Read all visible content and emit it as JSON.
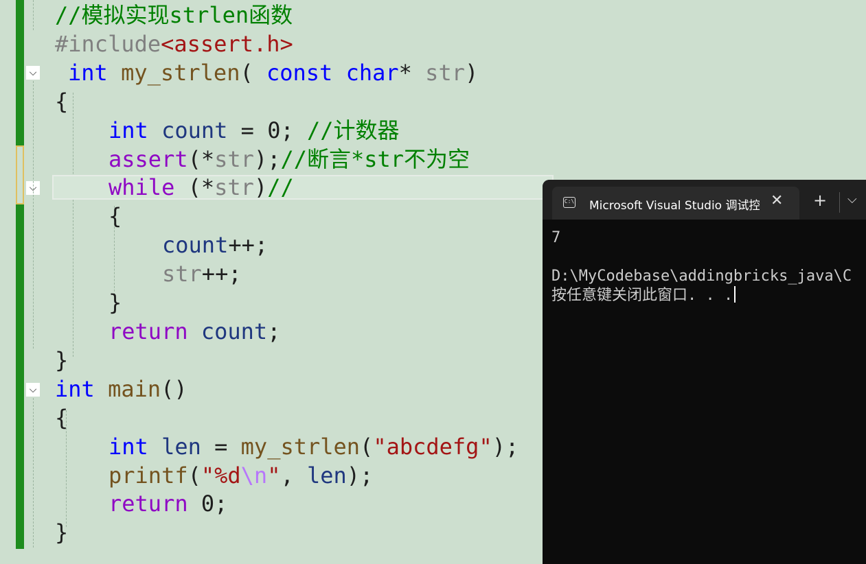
{
  "editor": {
    "lines": {
      "l1": {
        "comment": "//模拟实现strlen函数"
      },
      "l2": {
        "directive": "#include",
        "header": "<assert.h>"
      },
      "l3": {
        "kw_int": "int",
        "fn": "my_strlen",
        "p1": "( ",
        "kw_const": "const",
        "sp1": " ",
        "kw_char": "char",
        "star": "* ",
        "param": "str",
        "p2": ")"
      },
      "l4": {
        "brace": "{"
      },
      "l5": {
        "kw_int": "int",
        "sp": " ",
        "var": "count",
        "rest": " = 0; ",
        "comment": "//计数器"
      },
      "l6": {
        "ctl": "assert",
        "p1": "(*",
        "param": "str",
        "p2": ");",
        "comment": "//断言*str不为空"
      },
      "l7": {
        "ctl": "while",
        "p1": " (*",
        "param": "str",
        "p2": ")",
        "comment": "//"
      },
      "l8": {
        "brace": "{"
      },
      "l9": {
        "var": "count",
        "rest": "++;"
      },
      "l10": {
        "param": "str",
        "rest": "++;"
      },
      "l11": {
        "brace": "}"
      },
      "l12": {
        "ctl": "return",
        "sp": " ",
        "var": "count",
        "rest": ";"
      },
      "l13": {
        "brace": "}"
      },
      "l14": {
        "kw_int": "int",
        "sp": " ",
        "fn": "main",
        "rest": "()"
      },
      "l15": {
        "brace": "{"
      },
      "l16": {
        "kw_int": "int",
        "sp": " ",
        "var": "len",
        "eq": " = ",
        "fn": "my_strlen",
        "p1": "(",
        "str": "\"abcdefg\"",
        "p2": ");"
      },
      "l17": {
        "fn": "printf",
        "p1": "(",
        "str1": "\"%d",
        "esc": "\\n",
        "str2": "\"",
        "p2": ", ",
        "var": "len",
        "p3": ");"
      },
      "l18": {
        "ctl": "return",
        "rest": " 0;"
      },
      "l19": {
        "brace": "}"
      }
    }
  },
  "console": {
    "tab_title": "Microsoft Visual Studio 调试控制台",
    "tab_icon_text": "C:\\",
    "close_glyph": "✕",
    "add_glyph": "+",
    "dropdown_glyph": "⌵",
    "output": [
      "7",
      "",
      "D:\\MyCodebase\\addingbricks_java\\C",
      "按任意键关闭此窗口. . ."
    ]
  },
  "icons": {
    "collapse": "chevron-down-icon"
  },
  "colors": {
    "editor_bg": "#cddfcf",
    "change_bar": "#1e8c1e",
    "console_bg": "#0c0c0c"
  }
}
